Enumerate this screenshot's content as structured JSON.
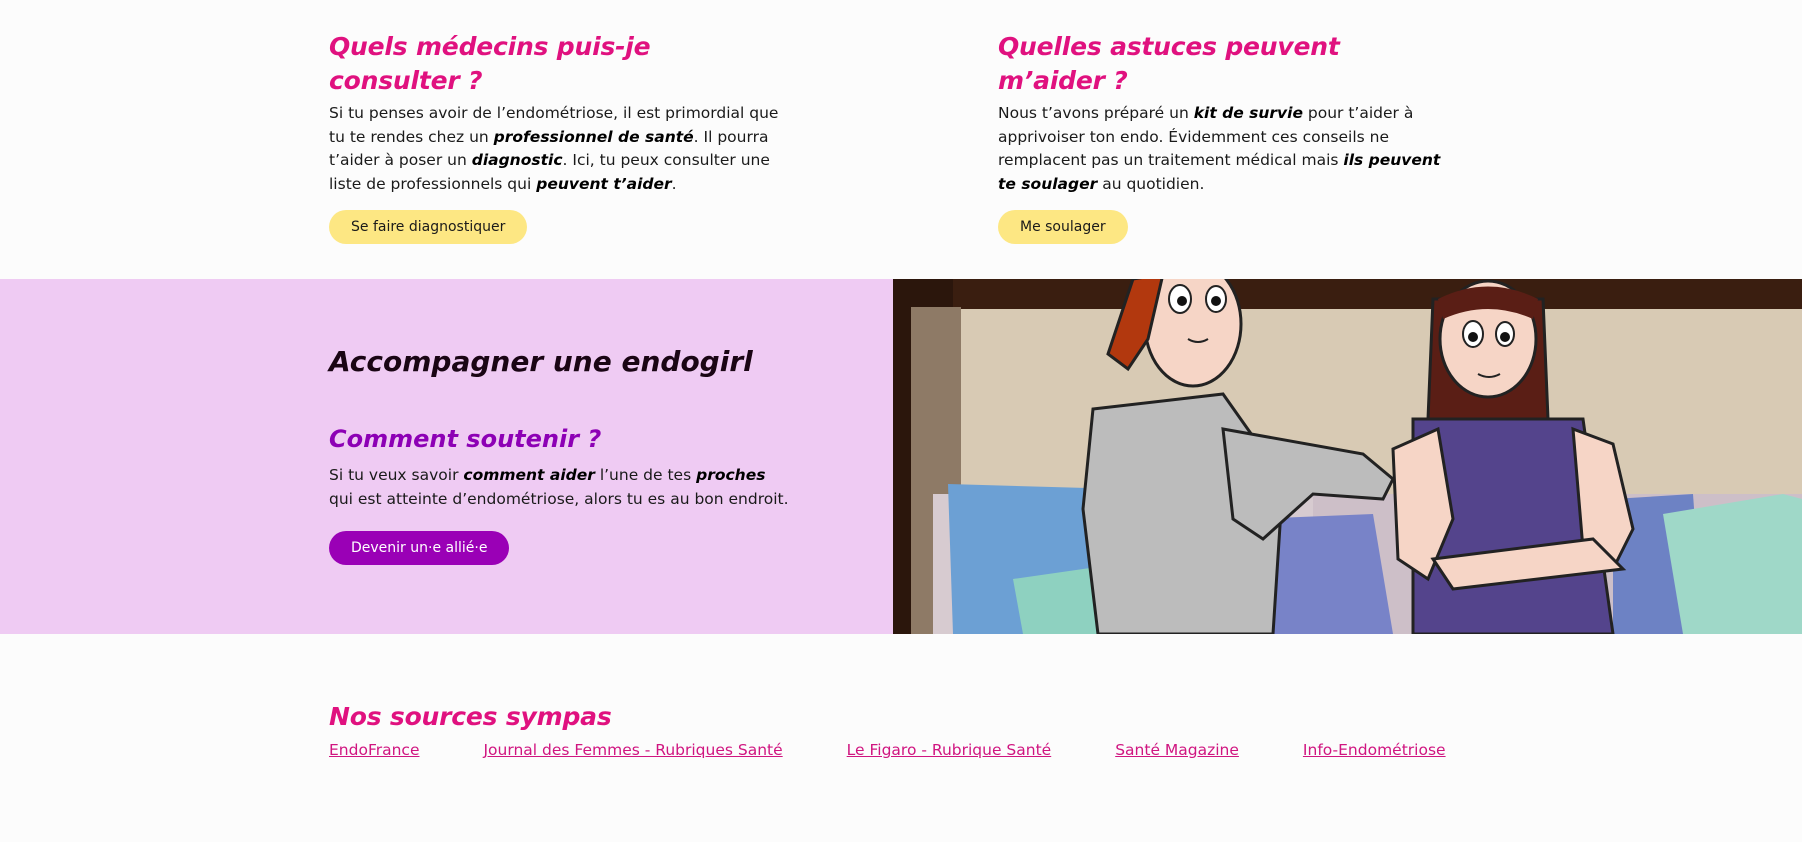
{
  "diagnosis": {
    "title": "Quels médecins puis-je consulter ?",
    "text_1": "Si tu penses avoir de l’endométriose, il est primordial que tu te rendes chez un ",
    "bold_1": "professionnel de santé",
    "text_2": ". Il pourra t’aider à poser un ",
    "bold_2": "diagnostic",
    "text_3": ". Ici, tu peux consulter une liste de professionnels qui ",
    "bold_3": "peuvent t’aider",
    "text_4": ".",
    "button_label": "Se faire diagnostiquer"
  },
  "tips": {
    "title": "Quelles astuces peuvent m’aider ?",
    "text_1": "Nous t’avons préparé un ",
    "bold_1": "kit de survie",
    "text_2": " pour t’aider à apprivoiser ton endo. Évidemment ces conseils ne remplacent pas un traitement médical mais ",
    "bold_2": "ils peuvent te soulager",
    "text_3": " au quotidien.",
    "button_label": "Me soulager"
  },
  "support": {
    "title": "Accompagner une endogirl",
    "subtitle": "Comment soutenir ?",
    "text_1": "Si tu veux savoir ",
    "bold_1": "comment aider",
    "text_2": " l’une de tes ",
    "bold_2": "proches",
    "text_3": " qui est atteinte d’endométriose, alors tu es au bon endroit.",
    "button_label": "Devenir un·e allié·e"
  },
  "sources": {
    "title": "Nos sources sympas",
    "links": [
      "EndoFrance",
      "Journal des Femmes - Rubriques Santé",
      "Le Figaro - Rubrique Santé",
      "Santé Magazine",
      "Info-Endométriose"
    ]
  },
  "colors": {
    "accent_pink": "#e0117f",
    "accent_purple": "#8d00b5",
    "band_background": "#efcbf3",
    "button_yellow": "#fde783"
  }
}
